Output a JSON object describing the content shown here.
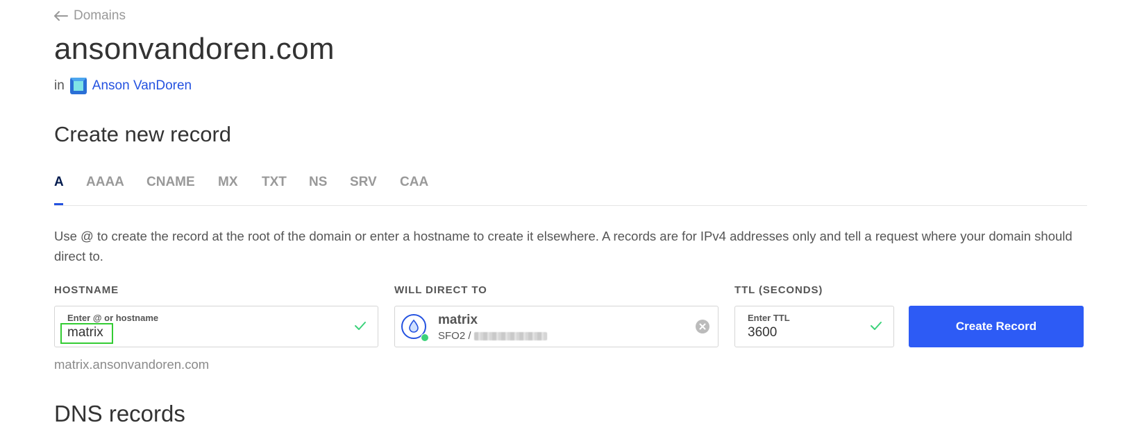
{
  "nav": {
    "back_label": "Domains"
  },
  "domain": {
    "name": "ansonvandoren.com",
    "in_label": "in",
    "team_name": "Anson VanDoren"
  },
  "create_record": {
    "title": "Create new record",
    "tabs": [
      "A",
      "AAAA",
      "CNAME",
      "MX",
      "TXT",
      "NS",
      "SRV",
      "CAA"
    ],
    "active_tab": "A",
    "description": "Use @ to create the record at the root of the domain or enter a hostname to create it elsewhere. A records are for IPv4 addresses only and tell a request where your domain should direct to.",
    "hostname": {
      "label": "HOSTNAME",
      "caption": "Enter @ or hostname",
      "value": "matrix",
      "fqdn": "matrix.ansonvandoren.com"
    },
    "direct_to": {
      "label": "WILL DIRECT TO",
      "droplet_name": "matrix",
      "region": "SFO2 /"
    },
    "ttl": {
      "label": "TTL (SECONDS)",
      "caption": "Enter TTL",
      "value": "3600"
    },
    "submit_label": "Create Record"
  },
  "dns_records": {
    "title": "DNS records"
  },
  "colors": {
    "accent": "#2d5bf5",
    "link": "#2452e0",
    "check": "#3bd27a",
    "highlight": "#33cc33"
  }
}
